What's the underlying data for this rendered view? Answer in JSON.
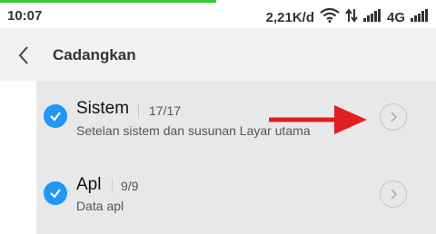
{
  "status_bar": {
    "time": "10:07",
    "speed": "2,21K/d",
    "network": "4G"
  },
  "header": {
    "title": "Cadangkan"
  },
  "items": [
    {
      "title": "Sistem",
      "count": "17/17",
      "subtitle": "Setelan sistem dan susunan Layar utama",
      "checked": true
    },
    {
      "title": "Apl",
      "count": "9/9",
      "subtitle": "Data apl",
      "checked": true
    }
  ],
  "colors": {
    "accent": "#2196f3",
    "annotation_arrow": "#e02020",
    "progress": "#33cc33"
  }
}
